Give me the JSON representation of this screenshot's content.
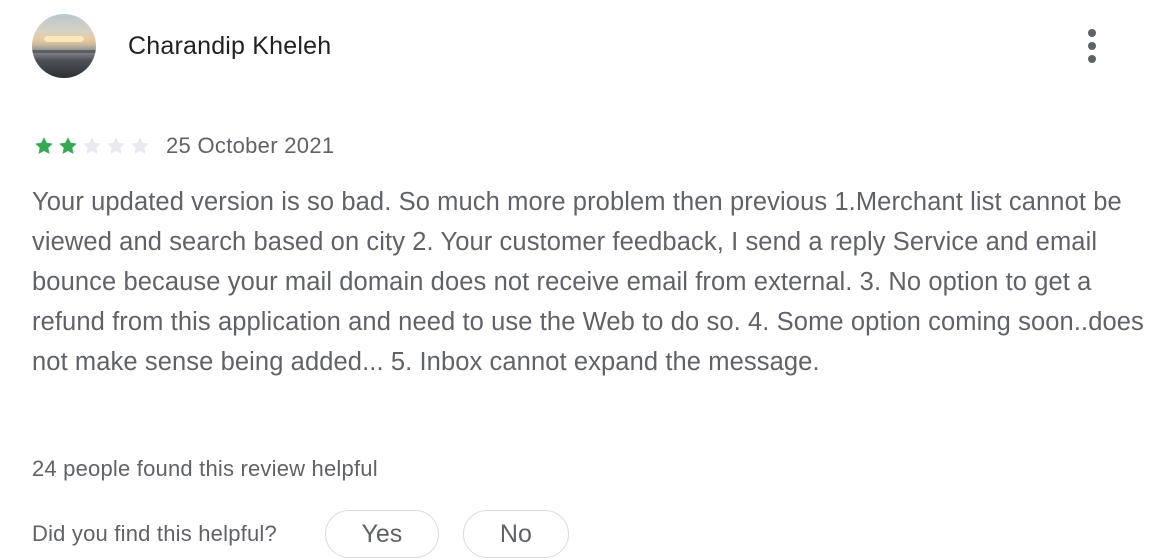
{
  "review": {
    "author": "Charandip Kheleh",
    "rating": 2,
    "max_rating": 5,
    "date": "25 October 2021",
    "text": "Your updated version is so bad. So much more problem then previous 1.Merchant list cannot be viewed and search based on city 2. Your customer feedback, I send a reply Service and email bounce because your mail domain does not receive email from external. 3. No option to get a refund from this application and need to use the Web to do so. 4. Some option coming soon..does not make sense being added... 5. Inbox cannot expand the message.",
    "helpful_count_text": "24 people found this review helpful"
  },
  "feedback": {
    "question": "Did you find this helpful?",
    "yes_label": "Yes",
    "no_label": "No"
  },
  "icons": {
    "avatar": "user-photo-avatar",
    "more": "more-vert-icon",
    "star": "star-icon"
  },
  "colors": {
    "star_filled": "#34a853",
    "star_empty": "#e8eaed",
    "text_primary": "#202124",
    "text_secondary": "#5f6368",
    "pill_border": "#dadce0"
  }
}
